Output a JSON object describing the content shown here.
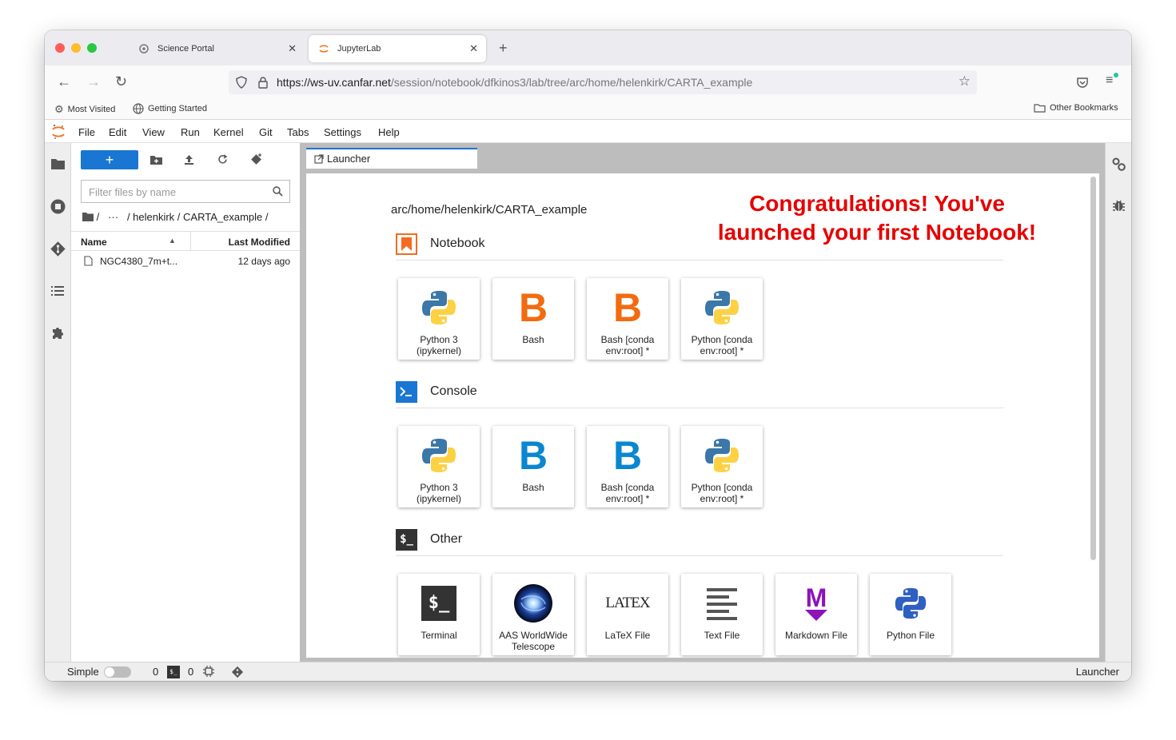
{
  "browser": {
    "tabs": [
      {
        "label": "Science Portal"
      },
      {
        "label": "JupyterLab"
      }
    ],
    "url_domain": "https://ws-uv.canfar.net",
    "url_path": "/session/notebook/dfkinos3/lab/tree/arc/home/helenkirk/CARTA_example",
    "bookmarks": [
      "Most Visited",
      "Getting Started"
    ],
    "other_bookmarks": "Other Bookmarks"
  },
  "menu": [
    "File",
    "Edit",
    "View",
    "Run",
    "Kernel",
    "Git",
    "Tabs",
    "Settings",
    "Help"
  ],
  "filebrowser": {
    "new_label": "+",
    "filter_placeholder": "Filter files by name",
    "breadcrumb_root": "/",
    "breadcrumb_ellipsis": "···",
    "breadcrumb_path": "/ helenkirk / CARTA_example /",
    "col_name": "Name",
    "col_modified": "Last Modified",
    "files": [
      {
        "name": "NGC4380_7m+t...",
        "modified": "12 days ago"
      }
    ]
  },
  "launcher": {
    "tab_label": "Launcher",
    "path": "arc/home/helenkirk/CARTA_example",
    "annotation_line1": "Congratulations!  You've",
    "annotation_line2": "launched your first Notebook!",
    "sections": {
      "notebook": {
        "title": "Notebook",
        "items": [
          "Python 3 (ipykernel)",
          "Bash",
          "Bash [conda env:root] *",
          "Python [conda env:root] *"
        ]
      },
      "console": {
        "title": "Console",
        "items": [
          "Python 3 (ipykernel)",
          "Bash",
          "Bash [conda env:root] *",
          "Python [conda env:root] *"
        ]
      },
      "other": {
        "title": "Other",
        "items": [
          "Terminal",
          "AAS WorldWide Telescope",
          "LaTeX File",
          "Text File",
          "Markdown File",
          "Python File"
        ]
      }
    },
    "icon_text": {
      "bash": "B",
      "terminal": "$_",
      "console": ">_",
      "other": "$_",
      "latex": "LATEX",
      "markdown": "M"
    }
  },
  "statusbar": {
    "mode_label": "Simple",
    "kernels_count": "0",
    "terminals_count": "0",
    "right_label": "Launcher"
  },
  "colors": {
    "accent": "#1976d2",
    "annotation": "#e60000",
    "notebook_icon": "#f26b21",
    "bash_orange": "#f26b0f",
    "bash_blue": "#0a87d0",
    "markdown_purple": "#8d13ba"
  }
}
